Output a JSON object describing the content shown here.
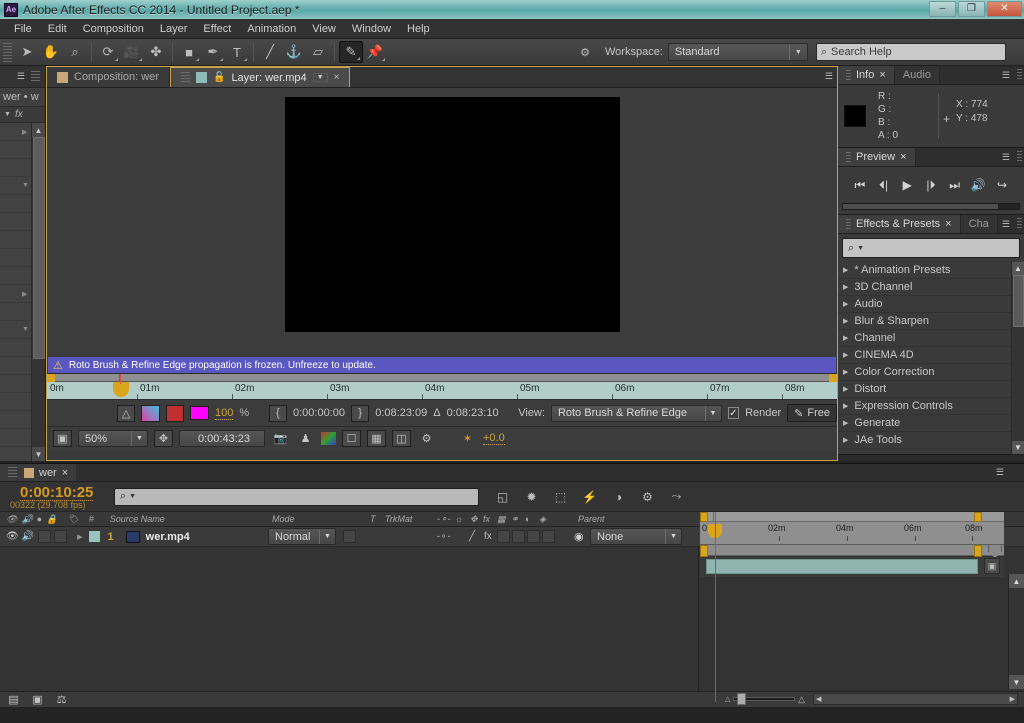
{
  "window": {
    "title": "Adobe After Effects CC 2014 - Untitled Project.aep *",
    "app_badge": "Ae",
    "minimize": "–",
    "maximize": "❐",
    "close": "✕"
  },
  "menubar": {
    "items": [
      "File",
      "Edit",
      "Composition",
      "Layer",
      "Effect",
      "Animation",
      "View",
      "Window",
      "Help"
    ]
  },
  "toolbar": {
    "tools": [
      {
        "name": "selection-tool",
        "glyph": "➤"
      },
      {
        "name": "hand-tool",
        "glyph": "✋"
      },
      {
        "name": "zoom-tool",
        "glyph": "⌕"
      },
      {
        "name": "rotation-tool",
        "glyph": "⟳"
      },
      {
        "name": "camera-tool",
        "glyph": "🎥"
      },
      {
        "name": "pan-behind-tool",
        "glyph": "✤"
      },
      {
        "name": "shape-tool",
        "glyph": "■"
      },
      {
        "name": "pen-tool",
        "glyph": "✒"
      },
      {
        "name": "type-tool",
        "glyph": "T"
      },
      {
        "name": "brush-tool",
        "glyph": "╱"
      },
      {
        "name": "clone-stamp-tool",
        "glyph": "⚓"
      },
      {
        "name": "eraser-tool",
        "glyph": "▱"
      },
      {
        "name": "roto-brush-tool",
        "glyph": "✎"
      },
      {
        "name": "puppet-pin-tool",
        "glyph": "📌"
      }
    ],
    "selected_tool": "roto-brush-tool",
    "workspace_label": "Workspace:",
    "workspace_value": "Standard",
    "search_help_placeholder": "Search Help"
  },
  "project_panel": {
    "name_display": "wer • w",
    "fx_header": "fx"
  },
  "viewer": {
    "tabs": [
      {
        "label": "Composition: wer",
        "active": false,
        "swatch": "tan"
      },
      {
        "label": "Layer: wer.mp4",
        "active": true,
        "swatch": "teal"
      }
    ],
    "lock_icon": "🔓",
    "close_icon": "×",
    "warning": "Roto Brush & Refine Edge propagation is frozen. Unfreeze to update.",
    "warning_icon": "⚠",
    "ruler_ticks": [
      "0m",
      "01m",
      "02m",
      "03m",
      "04m",
      "05m",
      "06m",
      "07m",
      "08m"
    ],
    "controls": {
      "opacity": "100",
      "percent_sign": "%",
      "in_point": "0:00:00:00",
      "out_point": "0:08:23:09",
      "duration_symbol": "Δ",
      "duration": "0:08:23:10",
      "view_label": "View:",
      "view_value": "Roto Brush & Refine Edge",
      "render_label": "Render",
      "render_checked": "✓",
      "freeze_label": "Free",
      "zoom": "50%",
      "current_time": "0:00:43:23",
      "exposure": "+0.0"
    }
  },
  "info_panel": {
    "tabs": [
      "Info",
      "Audio"
    ],
    "active_tab": "Info",
    "close_icon": "×",
    "channels": [
      "R :",
      "G :",
      "B :",
      "A : 0"
    ],
    "x_label": "X : 774",
    "y_label": "Y : 478",
    "swatch_color": "#000000"
  },
  "preview_panel": {
    "tab": "Preview",
    "close_icon": "×",
    "buttons": [
      {
        "name": "first-frame-button",
        "glyph": "⏮"
      },
      {
        "name": "previous-frame-button",
        "glyph": "⏴|"
      },
      {
        "name": "play-button",
        "glyph": "▶"
      },
      {
        "name": "next-frame-button",
        "glyph": "|⏵"
      },
      {
        "name": "last-frame-button",
        "glyph": "⏭"
      },
      {
        "name": "audio-toggle-button",
        "glyph": "🔊"
      },
      {
        "name": "loop-button",
        "glyph": "↪"
      }
    ]
  },
  "effects_panel": {
    "tabs": [
      "Effects & Presets",
      "Cha"
    ],
    "active_tab": "Effects & Presets",
    "close_icon": "×",
    "search_placeholder": "",
    "search_icon": "⌕",
    "categories": [
      "* Animation Presets",
      "3D Channel",
      "Audio",
      "Blur & Sharpen",
      "Channel",
      "CINEMA 4D",
      "Color Correction",
      "Distort",
      "Expression Controls",
      "Generate",
      "JAe Tools"
    ]
  },
  "timeline": {
    "tab_label": "wer",
    "tab_close": "×",
    "current_time": "0:00:10:25",
    "frame_info": "00322 (29.708 fps)",
    "search_placeholder": "",
    "columns": [
      "Source Name",
      "Mode",
      "T",
      "TrkMat",
      "Parent"
    ],
    "toggle_icons": [
      "👁",
      "🔊",
      "●",
      "🔒"
    ],
    "index_header": "#",
    "layers": [
      {
        "index": "1",
        "source_name": "wer.mp4",
        "mode": "Normal",
        "parent": "None",
        "visible": true,
        "audio": true
      }
    ],
    "ruler_ticks": [
      "0",
      "02m",
      "04m",
      "06m",
      "08m"
    ],
    "panel_icons": [
      {
        "name": "graph-editor-icon",
        "glyph": "◱"
      },
      {
        "name": "motion-blur-icon",
        "glyph": "✹"
      },
      {
        "name": "frame-blend-icon",
        "glyph": "⬚"
      },
      {
        "name": "brainstorm-icon",
        "glyph": "⚡"
      },
      {
        "name": "shy-icon",
        "glyph": "◑"
      },
      {
        "name": "live-update-icon",
        "glyph": "⚙"
      },
      {
        "name": "curves-icon",
        "glyph": "⤳"
      }
    ]
  },
  "statusbar": {
    "icons": [
      {
        "name": "toggle-switches-modes-icon",
        "glyph": "▤"
      },
      {
        "name": "comp-flowchart-icon",
        "glyph": "▣"
      },
      {
        "name": "exposure-icon",
        "glyph": "⚖"
      }
    ],
    "zoom_out_icon": "△",
    "zoom_in_icon": "△",
    "scroll_left": "◀",
    "scroll_right": "▶"
  },
  "colors": {
    "accent_gold": "#c8a24b",
    "warning_purple": "#5b57c0",
    "cti_red": "#e0392b",
    "timecode_gold": "#d79a1e",
    "layer_bar": "#8fb5ae"
  }
}
